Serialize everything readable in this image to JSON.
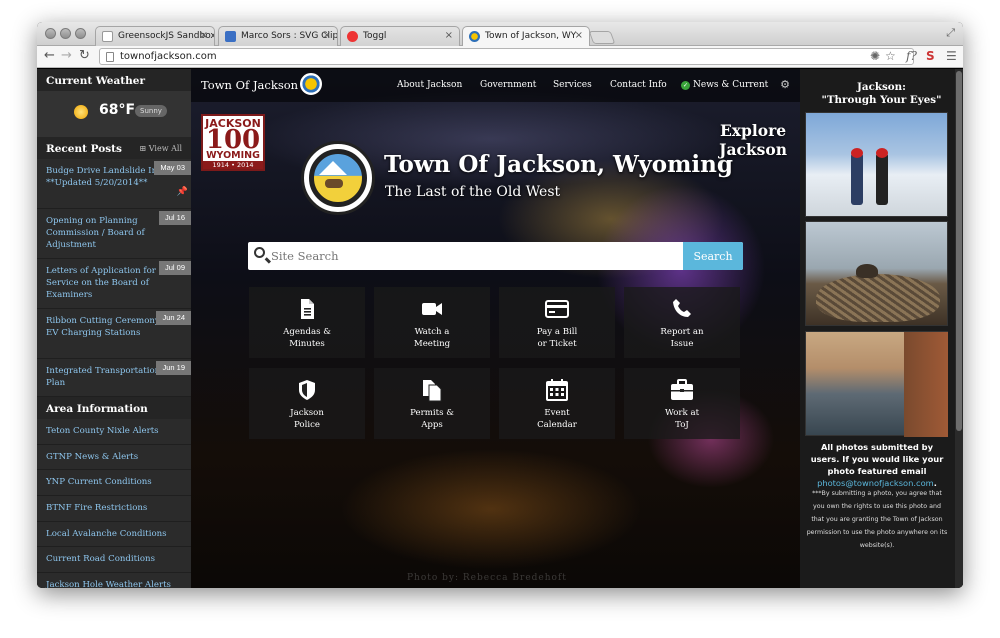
{
  "browser": {
    "tabs": [
      {
        "title": "GreensockJS Sandbox",
        "icon": "page-icon"
      },
      {
        "title": "Marco Sors : SVG ClipPath",
        "icon": "codepen-icon"
      },
      {
        "title": "Toggl",
        "icon": "toggl-icon"
      },
      {
        "title": "Town of Jackson, WY",
        "icon": "jackson-seal-icon",
        "active": true
      }
    ],
    "url": "townofjackson.com"
  },
  "left": {
    "weather_heading": "Current Weather",
    "temperature": "68°F",
    "condition": "Sunny",
    "posts_heading": "Recent Posts",
    "view_all": "View All",
    "posts": [
      {
        "title": "Budge Drive Landslide Info **Updated 5/20/2014**",
        "date": "May 03"
      },
      {
        "title": "Opening on Planning Commission / Board of Adjustment",
        "date": "Jul 16"
      },
      {
        "title": "Letters of Application for Service on the Board of Examiners",
        "date": "Jul 09"
      },
      {
        "title": "Ribbon Cutting Ceremony - EV Charging Stations",
        "date": "Jun 24"
      },
      {
        "title": "Integrated Transportation Plan",
        "date": "Jun 19"
      }
    ],
    "area_heading": "Area Information",
    "area_links": [
      "Teton County Nixle Alerts",
      "GTNP News & Alerts",
      "YNP Current Conditions",
      "BTNF Fire Restrictions",
      "Local Avalanche Conditions",
      "Current Road Conditions",
      "Jackson Hole Weather Alerts"
    ]
  },
  "nav": {
    "brand": "Town Of Jackson",
    "links": [
      "About Jackson",
      "Government",
      "Services",
      "Contact Info",
      "News & Current"
    ]
  },
  "hero": {
    "badge": {
      "line1": "JACKSON",
      "line2": "100",
      "line3": "WYOMING",
      "line4": "1914 • 2014"
    },
    "title": "Town Of Jackson, Wyoming",
    "subtitle": "The Last of the Old West",
    "explore_line1": "Explore",
    "explore_line2": "Jackson",
    "search_placeholder": "Site Search",
    "search_button": "Search",
    "photo_credit": "Photo by: Rebecca Bredehoft"
  },
  "tiles": [
    {
      "line1": "Agendas &",
      "line2": "Minutes",
      "icon": "document-icon"
    },
    {
      "line1": "Watch a",
      "line2": "Meeting",
      "icon": "video-camera-icon"
    },
    {
      "line1": "Pay a Bill",
      "line2": "or Ticket",
      "icon": "credit-card-icon"
    },
    {
      "line1": "Report an",
      "line2": "Issue",
      "icon": "phone-icon"
    },
    {
      "line1": "Jackson",
      "line2": "Police",
      "icon": "shield-icon"
    },
    {
      "line1": "Permits &",
      "line2": "Apps",
      "icon": "files-icon"
    },
    {
      "line1": "Event",
      "line2": "Calendar",
      "icon": "calendar-icon"
    },
    {
      "line1": "Work at",
      "line2": "ToJ",
      "icon": "briefcase-icon"
    }
  ],
  "right": {
    "title_line1": "Jackson:",
    "title_line2": "\"Through Your Eyes\"",
    "note": "All photos submitted by users. If you would like your photo featured email",
    "email": "photos@townofjackson.com",
    "fine_print": "***By submitting a photo, you agree that you own the rights to use this photo and that you are granting the Town of Jackson permission to use the photo anywhere on its website(s)."
  },
  "colors": {
    "link": "#8ec6ee",
    "search_button": "#5bb7dc",
    "badge_red": "#8b1a1a"
  }
}
